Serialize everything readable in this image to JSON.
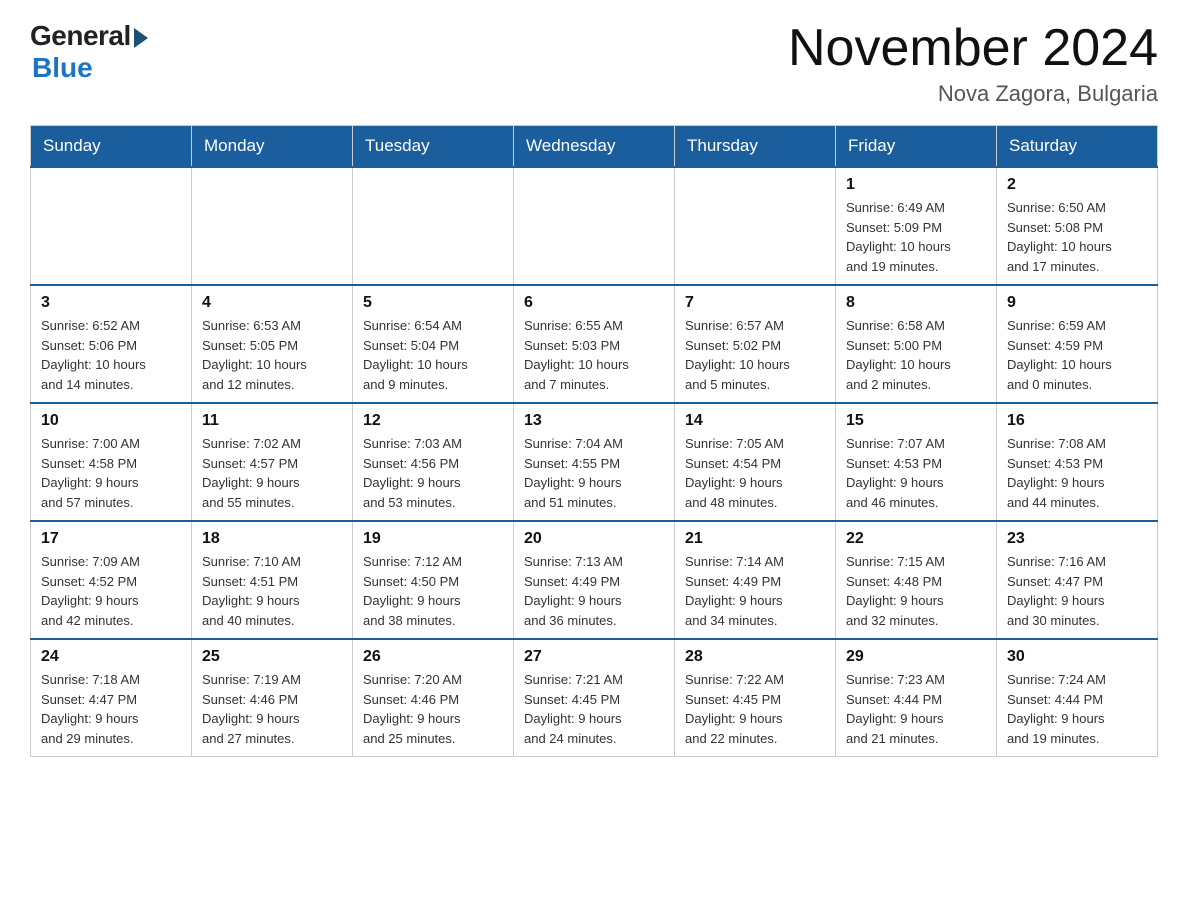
{
  "logo": {
    "general": "General",
    "blue": "Blue"
  },
  "title": "November 2024",
  "location": "Nova Zagora, Bulgaria",
  "days_of_week": [
    "Sunday",
    "Monday",
    "Tuesday",
    "Wednesday",
    "Thursday",
    "Friday",
    "Saturday"
  ],
  "weeks": [
    [
      {
        "day": "",
        "info": ""
      },
      {
        "day": "",
        "info": ""
      },
      {
        "day": "",
        "info": ""
      },
      {
        "day": "",
        "info": ""
      },
      {
        "day": "",
        "info": ""
      },
      {
        "day": "1",
        "info": "Sunrise: 6:49 AM\nSunset: 5:09 PM\nDaylight: 10 hours\nand 19 minutes."
      },
      {
        "day": "2",
        "info": "Sunrise: 6:50 AM\nSunset: 5:08 PM\nDaylight: 10 hours\nand 17 minutes."
      }
    ],
    [
      {
        "day": "3",
        "info": "Sunrise: 6:52 AM\nSunset: 5:06 PM\nDaylight: 10 hours\nand 14 minutes."
      },
      {
        "day": "4",
        "info": "Sunrise: 6:53 AM\nSunset: 5:05 PM\nDaylight: 10 hours\nand 12 minutes."
      },
      {
        "day": "5",
        "info": "Sunrise: 6:54 AM\nSunset: 5:04 PM\nDaylight: 10 hours\nand 9 minutes."
      },
      {
        "day": "6",
        "info": "Sunrise: 6:55 AM\nSunset: 5:03 PM\nDaylight: 10 hours\nand 7 minutes."
      },
      {
        "day": "7",
        "info": "Sunrise: 6:57 AM\nSunset: 5:02 PM\nDaylight: 10 hours\nand 5 minutes."
      },
      {
        "day": "8",
        "info": "Sunrise: 6:58 AM\nSunset: 5:00 PM\nDaylight: 10 hours\nand 2 minutes."
      },
      {
        "day": "9",
        "info": "Sunrise: 6:59 AM\nSunset: 4:59 PM\nDaylight: 10 hours\nand 0 minutes."
      }
    ],
    [
      {
        "day": "10",
        "info": "Sunrise: 7:00 AM\nSunset: 4:58 PM\nDaylight: 9 hours\nand 57 minutes."
      },
      {
        "day": "11",
        "info": "Sunrise: 7:02 AM\nSunset: 4:57 PM\nDaylight: 9 hours\nand 55 minutes."
      },
      {
        "day": "12",
        "info": "Sunrise: 7:03 AM\nSunset: 4:56 PM\nDaylight: 9 hours\nand 53 minutes."
      },
      {
        "day": "13",
        "info": "Sunrise: 7:04 AM\nSunset: 4:55 PM\nDaylight: 9 hours\nand 51 minutes."
      },
      {
        "day": "14",
        "info": "Sunrise: 7:05 AM\nSunset: 4:54 PM\nDaylight: 9 hours\nand 48 minutes."
      },
      {
        "day": "15",
        "info": "Sunrise: 7:07 AM\nSunset: 4:53 PM\nDaylight: 9 hours\nand 46 minutes."
      },
      {
        "day": "16",
        "info": "Sunrise: 7:08 AM\nSunset: 4:53 PM\nDaylight: 9 hours\nand 44 minutes."
      }
    ],
    [
      {
        "day": "17",
        "info": "Sunrise: 7:09 AM\nSunset: 4:52 PM\nDaylight: 9 hours\nand 42 minutes."
      },
      {
        "day": "18",
        "info": "Sunrise: 7:10 AM\nSunset: 4:51 PM\nDaylight: 9 hours\nand 40 minutes."
      },
      {
        "day": "19",
        "info": "Sunrise: 7:12 AM\nSunset: 4:50 PM\nDaylight: 9 hours\nand 38 minutes."
      },
      {
        "day": "20",
        "info": "Sunrise: 7:13 AM\nSunset: 4:49 PM\nDaylight: 9 hours\nand 36 minutes."
      },
      {
        "day": "21",
        "info": "Sunrise: 7:14 AM\nSunset: 4:49 PM\nDaylight: 9 hours\nand 34 minutes."
      },
      {
        "day": "22",
        "info": "Sunrise: 7:15 AM\nSunset: 4:48 PM\nDaylight: 9 hours\nand 32 minutes."
      },
      {
        "day": "23",
        "info": "Sunrise: 7:16 AM\nSunset: 4:47 PM\nDaylight: 9 hours\nand 30 minutes."
      }
    ],
    [
      {
        "day": "24",
        "info": "Sunrise: 7:18 AM\nSunset: 4:47 PM\nDaylight: 9 hours\nand 29 minutes."
      },
      {
        "day": "25",
        "info": "Sunrise: 7:19 AM\nSunset: 4:46 PM\nDaylight: 9 hours\nand 27 minutes."
      },
      {
        "day": "26",
        "info": "Sunrise: 7:20 AM\nSunset: 4:46 PM\nDaylight: 9 hours\nand 25 minutes."
      },
      {
        "day": "27",
        "info": "Sunrise: 7:21 AM\nSunset: 4:45 PM\nDaylight: 9 hours\nand 24 minutes."
      },
      {
        "day": "28",
        "info": "Sunrise: 7:22 AM\nSunset: 4:45 PM\nDaylight: 9 hours\nand 22 minutes."
      },
      {
        "day": "29",
        "info": "Sunrise: 7:23 AM\nSunset: 4:44 PM\nDaylight: 9 hours\nand 21 minutes."
      },
      {
        "day": "30",
        "info": "Sunrise: 7:24 AM\nSunset: 4:44 PM\nDaylight: 9 hours\nand 19 minutes."
      }
    ]
  ]
}
